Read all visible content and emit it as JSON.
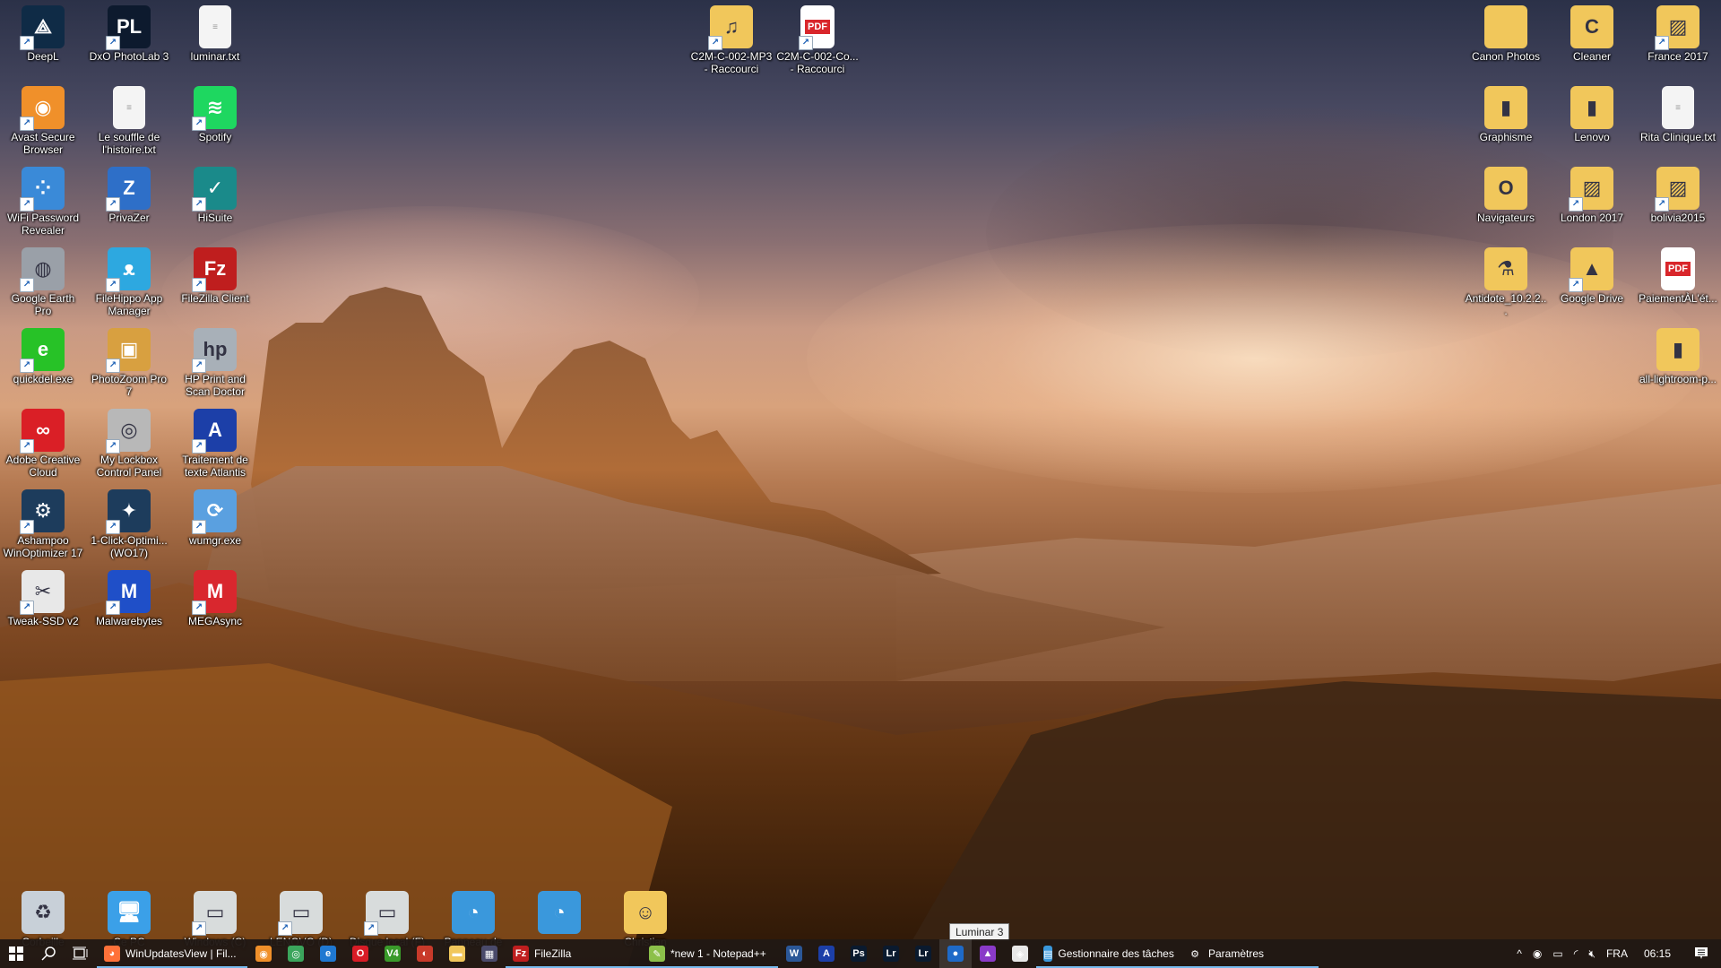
{
  "desktop": {
    "left_columns": [
      {
        "label": "DeepL",
        "icon": "deepl-icon",
        "color": "#0f2b46",
        "glyph": "⟁",
        "shortcut": true
      },
      {
        "label": "DxO PhotoLab 3",
        "icon": "dxo-photolab-icon",
        "color": "#0d1a2e",
        "glyph": "PL",
        "shortcut": true
      },
      {
        "label": "luminar.txt",
        "icon": "text-file-icon",
        "color": "#f4f4f4",
        "glyph": "≡",
        "shortcut": false
      },
      {
        "label": "Avast Secure Browser",
        "icon": "avast-browser-icon",
        "color": "#f0902a",
        "glyph": "◉",
        "shortcut": true
      },
      {
        "label": "Le souffle de l'histoire.txt",
        "icon": "text-file-icon",
        "color": "#f4f4f4",
        "glyph": "≡",
        "shortcut": false
      },
      {
        "label": "Spotify",
        "icon": "spotify-icon",
        "color": "#1ed760",
        "glyph": "≋",
        "shortcut": true
      },
      {
        "label": "WiFi Password Revealer",
        "icon": "wifi-password-icon",
        "color": "#3a8ad8",
        "glyph": "⁘",
        "shortcut": true
      },
      {
        "label": "PrivaZer",
        "icon": "privazer-icon",
        "color": "#2e6fc8",
        "glyph": "Z",
        "shortcut": true
      },
      {
        "label": "HiSuite",
        "icon": "hisuite-icon",
        "color": "#1a8a8a",
        "glyph": "✓",
        "shortcut": true
      },
      {
        "label": "Google Earth Pro",
        "icon": "google-earth-icon",
        "color": "#9aa0a8",
        "glyph": "◍",
        "shortcut": true
      },
      {
        "label": "FileHippo App Manager",
        "icon": "filehippo-icon",
        "color": "#2da8e0",
        "glyph": "ᴥ",
        "shortcut": true
      },
      {
        "label": "FileZilla Client",
        "icon": "filezilla-icon",
        "color": "#bf1e1e",
        "glyph": "Fz",
        "shortcut": true
      },
      {
        "label": "quickdel.exe",
        "icon": "quickdel-icon",
        "color": "#27c227",
        "glyph": "e",
        "shortcut": true
      },
      {
        "label": "PhotoZoom Pro 7",
        "icon": "photozoom-icon",
        "color": "#d8a040",
        "glyph": "▣",
        "shortcut": true
      },
      {
        "label": "HP Print and Scan Doctor",
        "icon": "hp-doctor-icon",
        "color": "#a8b0b8",
        "glyph": "hp",
        "shortcut": true
      },
      {
        "label": "Adobe Creative Cloud",
        "icon": "creative-cloud-icon",
        "color": "#da1f26",
        "glyph": "∞",
        "shortcut": true
      },
      {
        "label": "My Lockbox Control Panel",
        "icon": "lockbox-icon",
        "color": "#b8b8b8",
        "glyph": "◎",
        "shortcut": true
      },
      {
        "label": "Traitement de texte Atlantis",
        "icon": "atlantis-icon",
        "color": "#1c3fa8",
        "glyph": "A",
        "shortcut": true
      },
      {
        "label": "Ashampoo WinOptimizer 17",
        "icon": "winoptimizer-icon",
        "color": "#1d3c5c",
        "glyph": "⚙",
        "shortcut": true
      },
      {
        "label": "1-Click-Optimi... (WO17)",
        "icon": "one-click-optimizer-icon",
        "color": "#1d3c5c",
        "glyph": "✦",
        "shortcut": true
      },
      {
        "label": "wumgr.exe",
        "icon": "wumgr-icon",
        "color": "#5aa0e0",
        "glyph": "⟳",
        "shortcut": true
      },
      {
        "label": "Tweak-SSD v2",
        "icon": "tweak-ssd-icon",
        "color": "#e8e8e8",
        "glyph": "✂",
        "shortcut": true
      },
      {
        "label": "Malwarebytes",
        "icon": "malwarebytes-icon",
        "color": "#1f4fc8",
        "glyph": "M",
        "shortcut": true
      },
      {
        "label": "MEGAsync",
        "icon": "megasync-icon",
        "color": "#d9272e",
        "glyph": "M",
        "shortcut": true
      }
    ],
    "top_center": [
      {
        "label": "C2M-C-002-MP3 - Raccourci",
        "icon": "music-folder-icon",
        "color": "#f1c75b",
        "glyph": "♫",
        "shortcut": true
      },
      {
        "label": "C2M-C-002-Co... - Raccourci",
        "icon": "pdf-file-icon",
        "color": "#ffffff",
        "glyph": "PDF",
        "shortcut": true
      }
    ],
    "right_columns": [
      {
        "label": "Canon Photos",
        "icon": "folder-icon",
        "color": "#f1c75b",
        "glyph": "",
        "shortcut": false
      },
      {
        "label": "Cleaner",
        "icon": "folder-icon",
        "color": "#f1c75b",
        "glyph": "C",
        "shortcut": false
      },
      {
        "label": "France 2017",
        "icon": "folder-icon",
        "color": "#f1c75b",
        "glyph": "▨",
        "shortcut": true
      },
      {
        "label": "Graphisme",
        "icon": "folder-icon",
        "color": "#f1c75b",
        "glyph": "▮",
        "shortcut": false
      },
      {
        "label": "Lenovo",
        "icon": "folder-icon",
        "color": "#f1c75b",
        "glyph": "▮",
        "shortcut": false
      },
      {
        "label": "Rita Clinique.txt",
        "icon": "text-file-icon",
        "color": "#f4f4f4",
        "glyph": "≡",
        "shortcut": false
      },
      {
        "label": "Navigateurs",
        "icon": "folder-icon",
        "color": "#f1c75b",
        "glyph": "O",
        "shortcut": false
      },
      {
        "label": "London 2017",
        "icon": "folder-icon",
        "color": "#f1c75b",
        "glyph": "▨",
        "shortcut": true
      },
      {
        "label": "bolivia2015",
        "icon": "folder-icon",
        "color": "#f1c75b",
        "glyph": "▨",
        "shortcut": true
      },
      {
        "label": "Antidote_10.2.2...",
        "icon": "folder-icon",
        "color": "#f1c75b",
        "glyph": "⚗",
        "shortcut": false
      },
      {
        "label": "Google Drive",
        "icon": "google-drive-icon",
        "color": "#f1c75b",
        "glyph": "▲",
        "shortcut": true
      },
      {
        "label": "PaiementÀL'ét...",
        "icon": "pdf-file-icon",
        "color": "#ffffff",
        "glyph": "PDF",
        "shortcut": false
      },
      {
        "label": "all-lightroom-p...",
        "icon": "folder-icon",
        "color": "#f1c75b",
        "glyph": "▮",
        "shortcut": false
      }
    ],
    "bottom_row": [
      {
        "label": "Corbeille",
        "icon": "recycle-bin-icon",
        "color": "#c8d0d8",
        "glyph": "♻",
        "shortcut": false
      },
      {
        "label": "Ce PC",
        "icon": "this-pc-icon",
        "color": "#3ba0e8",
        "glyph": "🖥",
        "shortcut": false
      },
      {
        "label": "Windows (C)",
        "icon": "drive-icon",
        "color": "#d8dcdc",
        "glyph": "▭",
        "shortcut": true
      },
      {
        "label": "LENOVO (D)",
        "icon": "drive-icon",
        "color": "#d8dcdc",
        "glyph": "▭",
        "shortcut": true
      },
      {
        "label": "Disque local (F)",
        "icon": "drive-icon",
        "color": "#d8dcdc",
        "glyph": "▭",
        "shortcut": true
      },
      {
        "label": "Panneau de",
        "icon": "control-panel-icon",
        "color": "#3a98dc",
        "glyph": "◔",
        "shortcut": false
      },
      {
        "label": "",
        "icon": "control-panel-icon",
        "color": "#3a98dc",
        "glyph": "◔",
        "shortcut": false
      },
      {
        "label": "Christian",
        "icon": "user-folder-icon",
        "color": "#f1c75b",
        "glyph": "☺",
        "shortcut": false
      }
    ]
  },
  "tooltip": "Luminar 3",
  "taskbar": {
    "start": "start-icon",
    "search": "search-icon",
    "taskview": "task-view-icon",
    "items": [
      {
        "type": "task",
        "label": "WinUpdatesView | Fil...",
        "icon": "firefox-icon",
        "color": "#ff7139",
        "glyph": "◕",
        "open": true,
        "width": 168
      },
      {
        "type": "icon",
        "icon": "avast-browser-icon",
        "color": "#f0902a",
        "glyph": "◉"
      },
      {
        "type": "icon",
        "icon": "chrome-icon",
        "color": "#3ba55c",
        "glyph": "◎"
      },
      {
        "type": "icon",
        "icon": "edge-icon",
        "color": "#1f78d1",
        "glyph": "e"
      },
      {
        "type": "icon",
        "icon": "opera-icon",
        "color": "#d81c26",
        "glyph": "O"
      },
      {
        "type": "icon",
        "icon": "v4-icon",
        "color": "#3a9a2a",
        "glyph": "V4"
      },
      {
        "type": "icon",
        "icon": "app-red-green-icon",
        "color": "#c83a2a",
        "glyph": "◐"
      },
      {
        "type": "icon",
        "icon": "file-explorer-icon",
        "color": "#f1c75b",
        "glyph": "▬"
      },
      {
        "type": "icon",
        "icon": "film-icon",
        "color": "#4a4a6a",
        "glyph": "▦"
      },
      {
        "type": "task",
        "label": "FileZilla",
        "icon": "filezilla-icon",
        "color": "#bf1e1e",
        "glyph": "Fz",
        "open": true,
        "width": 152
      },
      {
        "type": "task",
        "label": "*new 1 - Notepad++",
        "icon": "notepadpp-icon",
        "color": "#8cc04a",
        "glyph": "✎",
        "open": true,
        "width": 152
      },
      {
        "type": "icon",
        "icon": "word-icon",
        "color": "#2b5797",
        "glyph": "W"
      },
      {
        "type": "icon",
        "icon": "atlantis-icon",
        "color": "#1c3fa8",
        "glyph": "A"
      },
      {
        "type": "icon",
        "icon": "photoshop-icon",
        "color": "#0a1a2e",
        "glyph": "Ps"
      },
      {
        "type": "icon",
        "icon": "lightroom-icon",
        "color": "#0a1a2e",
        "glyph": "Lr"
      },
      {
        "type": "icon",
        "icon": "lightroom-classic-icon",
        "color": "#0a1a2e",
        "glyph": "Lr"
      },
      {
        "type": "icon",
        "icon": "luminar-icon",
        "color": "#1e6ac8",
        "glyph": "●",
        "hover": true
      },
      {
        "type": "icon",
        "icon": "affinity-icon",
        "color": "#8a3ac8",
        "glyph": "▲"
      },
      {
        "type": "icon",
        "icon": "hisuite-taskbar-icon",
        "color": "#e8e8e8",
        "glyph": "◈"
      },
      {
        "type": "task",
        "label": "Gestionnaire des tâches",
        "icon": "task-manager-icon",
        "color": "#3a98dc",
        "glyph": "▤",
        "open": true,
        "width": 160
      },
      {
        "type": "task",
        "label": "Paramètres",
        "icon": "settings-gear-icon",
        "color": "transparent",
        "glyph": "⚙",
        "open": true,
        "width": 155
      }
    ]
  },
  "tray": {
    "chevron": "^",
    "language": "FRA",
    "time": "06:15",
    "icons": [
      "record-icon",
      "battery-charging-icon",
      "wifi-icon",
      "volume-muted-icon"
    ]
  }
}
